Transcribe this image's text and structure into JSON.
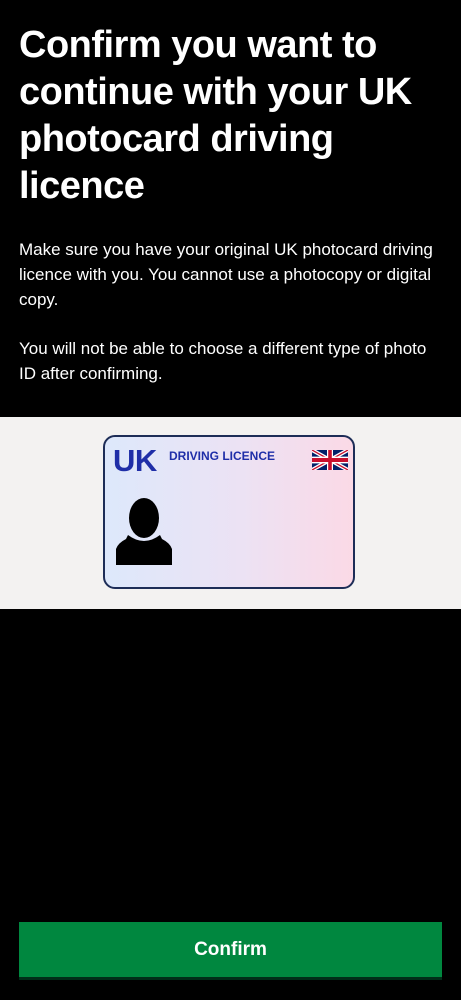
{
  "page": {
    "title": "Confirm you want to continue with your UK photocard driving licence",
    "paragraphs": [
      "Make sure you have your original UK photocard driving licence with you. You cannot use a photocopy or digital copy.",
      "You will not be able to choose a different type of photo ID after confirming."
    ]
  },
  "illustration": {
    "card_country": "UK",
    "card_heading": "DRIVING LICENCE",
    "flag_icon": "union-jack-flag-icon",
    "photo_icon": "person-silhouette-icon",
    "colors": {
      "panel_background": "#f3f2f1",
      "card_text": "#1f2ea8",
      "card_border": "#1d2d57"
    }
  },
  "actions": {
    "confirm_label": "Confirm",
    "confirm_color": "#00873f"
  }
}
